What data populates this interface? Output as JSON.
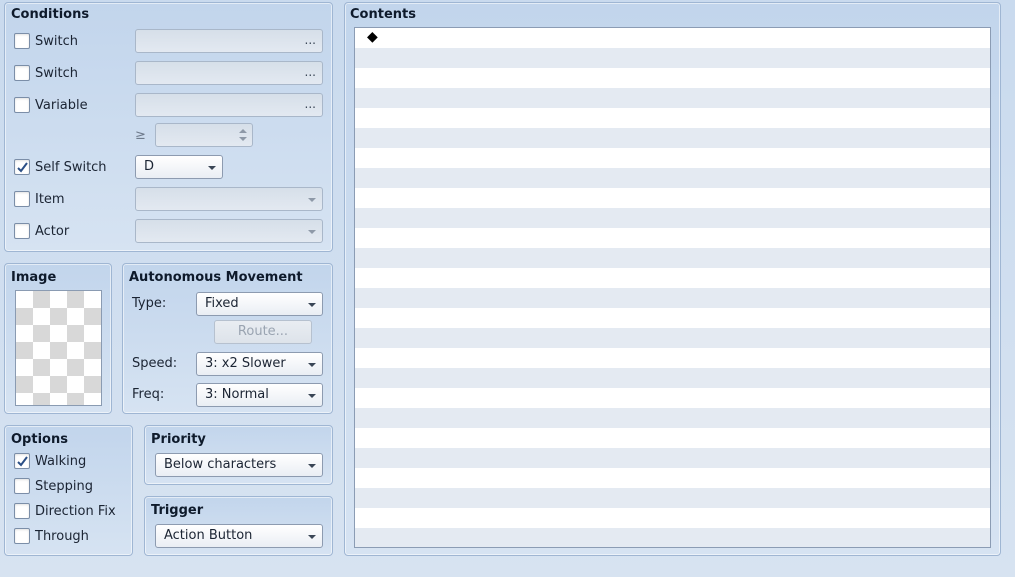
{
  "conditions": {
    "title": "Conditions",
    "switch1": {
      "label": "Switch",
      "checked": false,
      "value": "",
      "button": "..."
    },
    "switch2": {
      "label": "Switch",
      "checked": false,
      "value": "",
      "button": "..."
    },
    "variable": {
      "label": "Variable",
      "checked": false,
      "value": "",
      "button": "...",
      "operator": "≥",
      "number": ""
    },
    "self_switch": {
      "label": "Self Switch",
      "checked": true,
      "value": "D"
    },
    "item": {
      "label": "Item",
      "checked": false,
      "value": ""
    },
    "actor": {
      "label": "Actor",
      "checked": false,
      "value": ""
    }
  },
  "image": {
    "title": "Image"
  },
  "autonomous": {
    "title": "Autonomous Movement",
    "type_label": "Type:",
    "type_value": "Fixed",
    "route_button": "Route...",
    "speed_label": "Speed:",
    "speed_value": "3: x2 Slower",
    "freq_label": "Freq:",
    "freq_value": "3: Normal"
  },
  "options": {
    "title": "Options",
    "walking": {
      "label": "Walking",
      "checked": true
    },
    "stepping": {
      "label": "Stepping",
      "checked": false
    },
    "direction_fix": {
      "label": "Direction Fix",
      "checked": false
    },
    "through": {
      "label": "Through",
      "checked": false
    }
  },
  "priority": {
    "title": "Priority",
    "value": "Below characters"
  },
  "trigger": {
    "title": "Trigger",
    "value": "Action Button"
  },
  "contents": {
    "title": "Contents",
    "first_line_marker": "◆"
  }
}
